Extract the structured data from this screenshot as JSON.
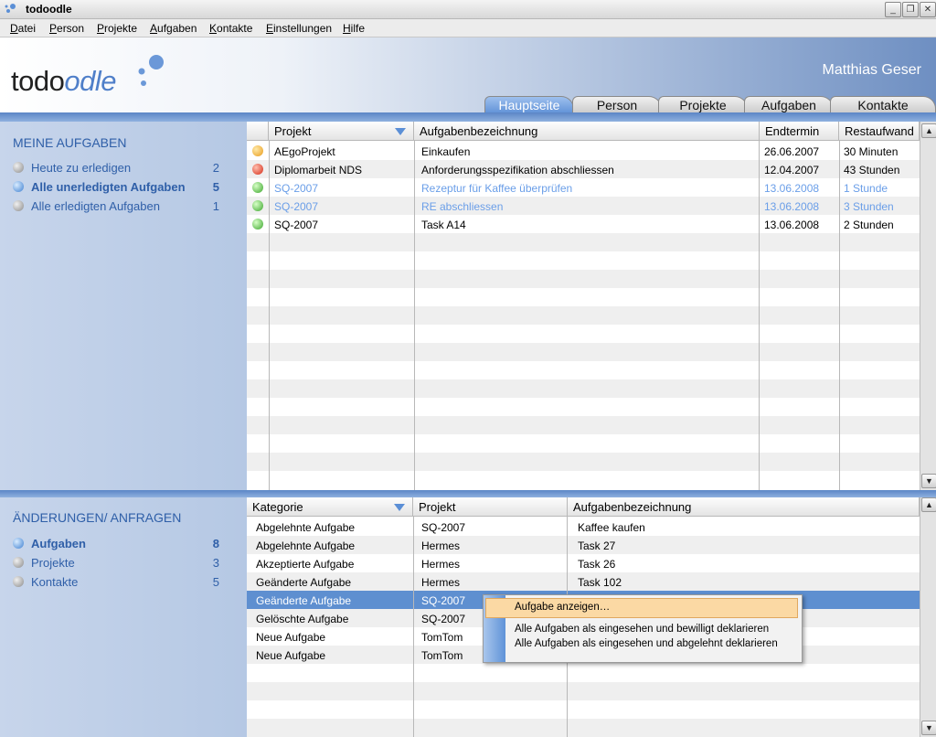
{
  "window": {
    "title": "todoodle",
    "minimize": "_",
    "restore": "❐",
    "close": "✕"
  },
  "menu": [
    {
      "first": "D",
      "rest": "atei"
    },
    {
      "first": "P",
      "rest": "erson"
    },
    {
      "first": "P",
      "rest": "rojekte"
    },
    {
      "first": "A",
      "rest": "ufgaben"
    },
    {
      "first": "K",
      "rest": "ontakte"
    },
    {
      "first": "E",
      "rest": "instellungen"
    },
    {
      "first": "H",
      "rest": "ilfe"
    }
  ],
  "header": {
    "logo_main": "todo",
    "logo_accent": "odle",
    "user": "Matthias Geser",
    "tabs": [
      "Hauptseite",
      "Person",
      "Projekte",
      "Aufgaben",
      "Kontakte"
    ],
    "active_tab": "Hauptseite"
  },
  "my_tasks": {
    "heading": "MEINE AUFGABEN",
    "filters": [
      {
        "label": "Heute zu erledigen",
        "count": "2"
      },
      {
        "label": "Alle unerledigten Aufgaben",
        "count": "5"
      },
      {
        "label": "Alle erledigten Aufgaben",
        "count": "1"
      }
    ],
    "columns": [
      "Projekt",
      "Aufgabenbezeichnung",
      "Endtermin",
      "Restaufwand"
    ],
    "rows": [
      {
        "status": "orange",
        "project": "AEgoProjekt",
        "task": "Einkaufen",
        "due": "26.06.2007",
        "effort": "30 Minuten",
        "done": false
      },
      {
        "status": "red",
        "project": "Diplomarbeit NDS",
        "task": "Anforderungsspezifikation abschliessen",
        "due": "12.04.2007",
        "effort": "43 Stunden",
        "done": false
      },
      {
        "status": "green",
        "project": "SQ-2007",
        "task": "Rezeptur für Kaffee überprüfen",
        "due": "13.06.2008",
        "effort": "1 Stunde",
        "done": true
      },
      {
        "status": "green",
        "project": "SQ-2007",
        "task": "RE abschliessen",
        "due": "13.06.2008",
        "effort": "3 Stunden",
        "done": true
      },
      {
        "status": "green",
        "project": "SQ-2007",
        "task": "Task A14",
        "due": "13.06.2008",
        "effort": "2 Stunden",
        "done": false
      }
    ]
  },
  "changes": {
    "heading": "ÄNDERUNGEN/ ANFRAGEN",
    "filters": [
      {
        "label": "Aufgaben",
        "count": "8"
      },
      {
        "label": "Projekte",
        "count": "3"
      },
      {
        "label": "Kontakte",
        "count": "5"
      }
    ],
    "columns": [
      "Kategorie",
      "Projekt",
      "Aufgabenbezeichnung"
    ],
    "rows": [
      {
        "category": "Abgelehnte Aufgabe",
        "project": "SQ-2007",
        "task": "Kaffee kaufen"
      },
      {
        "category": "Abgelehnte Aufgabe",
        "project": "Hermes",
        "task": "Task 27"
      },
      {
        "category": "Akzeptierte Aufgabe",
        "project": "Hermes",
        "task": "Task 26"
      },
      {
        "category": "Geänderte Aufgabe",
        "project": "Hermes",
        "task": "Task 102"
      },
      {
        "category": "Geänderte Aufgabe",
        "project": "SQ-2007",
        "task": ""
      },
      {
        "category": "Gelöschte Aufgabe",
        "project": "SQ-2007",
        "task": ""
      },
      {
        "category": "Neue Aufgabe",
        "project": "TomTom",
        "task": ""
      },
      {
        "category": "Neue Aufgabe",
        "project": "TomTom",
        "task": ""
      }
    ]
  },
  "context_menu": {
    "items": [
      "Aufgabe anzeigen…",
      "Alle Aufgaben als eingesehen und bewilligt deklarieren",
      "Alle Aufgaben als eingesehen und abgelehnt deklarieren"
    ]
  },
  "colors": {
    "accent": "#2f5fa8",
    "selection": "#5e8fd0",
    "done_text": "#6a9ee8",
    "menu_highlight": "#fbd9a4"
  },
  "icons": {
    "app": "todoodle-bubbles-icon",
    "scroll_up": "▲",
    "scroll_down": "▼"
  }
}
